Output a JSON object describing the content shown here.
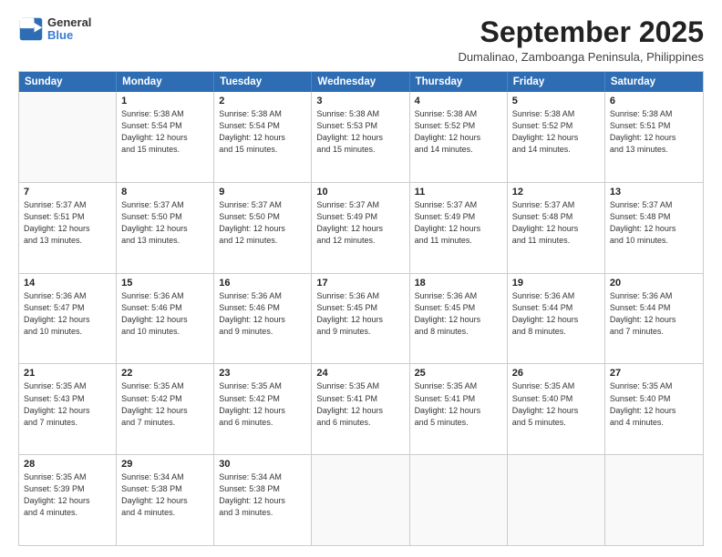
{
  "header": {
    "logo": {
      "line1": "General",
      "line2": "Blue"
    },
    "title": "September 2025",
    "subtitle": "Dumalinao, Zamboanga Peninsula, Philippines"
  },
  "calendar": {
    "days": [
      "Sunday",
      "Monday",
      "Tuesday",
      "Wednesday",
      "Thursday",
      "Friday",
      "Saturday"
    ],
    "weeks": [
      [
        {
          "day": "",
          "empty": true
        },
        {
          "day": "1",
          "line1": "Sunrise: 5:38 AM",
          "line2": "Sunset: 5:54 PM",
          "line3": "Daylight: 12 hours",
          "line4": "and 15 minutes."
        },
        {
          "day": "2",
          "line1": "Sunrise: 5:38 AM",
          "line2": "Sunset: 5:54 PM",
          "line3": "Daylight: 12 hours",
          "line4": "and 15 minutes."
        },
        {
          "day": "3",
          "line1": "Sunrise: 5:38 AM",
          "line2": "Sunset: 5:53 PM",
          "line3": "Daylight: 12 hours",
          "line4": "and 15 minutes."
        },
        {
          "day": "4",
          "line1": "Sunrise: 5:38 AM",
          "line2": "Sunset: 5:52 PM",
          "line3": "Daylight: 12 hours",
          "line4": "and 14 minutes."
        },
        {
          "day": "5",
          "line1": "Sunrise: 5:38 AM",
          "line2": "Sunset: 5:52 PM",
          "line3": "Daylight: 12 hours",
          "line4": "and 14 minutes."
        },
        {
          "day": "6",
          "line1": "Sunrise: 5:38 AM",
          "line2": "Sunset: 5:51 PM",
          "line3": "Daylight: 12 hours",
          "line4": "and 13 minutes."
        }
      ],
      [
        {
          "day": "7",
          "line1": "Sunrise: 5:37 AM",
          "line2": "Sunset: 5:51 PM",
          "line3": "Daylight: 12 hours",
          "line4": "and 13 minutes."
        },
        {
          "day": "8",
          "line1": "Sunrise: 5:37 AM",
          "line2": "Sunset: 5:50 PM",
          "line3": "Daylight: 12 hours",
          "line4": "and 13 minutes."
        },
        {
          "day": "9",
          "line1": "Sunrise: 5:37 AM",
          "line2": "Sunset: 5:50 PM",
          "line3": "Daylight: 12 hours",
          "line4": "and 12 minutes."
        },
        {
          "day": "10",
          "line1": "Sunrise: 5:37 AM",
          "line2": "Sunset: 5:49 PM",
          "line3": "Daylight: 12 hours",
          "line4": "and 12 minutes."
        },
        {
          "day": "11",
          "line1": "Sunrise: 5:37 AM",
          "line2": "Sunset: 5:49 PM",
          "line3": "Daylight: 12 hours",
          "line4": "and 11 minutes."
        },
        {
          "day": "12",
          "line1": "Sunrise: 5:37 AM",
          "line2": "Sunset: 5:48 PM",
          "line3": "Daylight: 12 hours",
          "line4": "and 11 minutes."
        },
        {
          "day": "13",
          "line1": "Sunrise: 5:37 AM",
          "line2": "Sunset: 5:48 PM",
          "line3": "Daylight: 12 hours",
          "line4": "and 10 minutes."
        }
      ],
      [
        {
          "day": "14",
          "line1": "Sunrise: 5:36 AM",
          "line2": "Sunset: 5:47 PM",
          "line3": "Daylight: 12 hours",
          "line4": "and 10 minutes."
        },
        {
          "day": "15",
          "line1": "Sunrise: 5:36 AM",
          "line2": "Sunset: 5:46 PM",
          "line3": "Daylight: 12 hours",
          "line4": "and 10 minutes."
        },
        {
          "day": "16",
          "line1": "Sunrise: 5:36 AM",
          "line2": "Sunset: 5:46 PM",
          "line3": "Daylight: 12 hours",
          "line4": "and 9 minutes."
        },
        {
          "day": "17",
          "line1": "Sunrise: 5:36 AM",
          "line2": "Sunset: 5:45 PM",
          "line3": "Daylight: 12 hours",
          "line4": "and 9 minutes."
        },
        {
          "day": "18",
          "line1": "Sunrise: 5:36 AM",
          "line2": "Sunset: 5:45 PM",
          "line3": "Daylight: 12 hours",
          "line4": "and 8 minutes."
        },
        {
          "day": "19",
          "line1": "Sunrise: 5:36 AM",
          "line2": "Sunset: 5:44 PM",
          "line3": "Daylight: 12 hours",
          "line4": "and 8 minutes."
        },
        {
          "day": "20",
          "line1": "Sunrise: 5:36 AM",
          "line2": "Sunset: 5:44 PM",
          "line3": "Daylight: 12 hours",
          "line4": "and 7 minutes."
        }
      ],
      [
        {
          "day": "21",
          "line1": "Sunrise: 5:35 AM",
          "line2": "Sunset: 5:43 PM",
          "line3": "Daylight: 12 hours",
          "line4": "and 7 minutes."
        },
        {
          "day": "22",
          "line1": "Sunrise: 5:35 AM",
          "line2": "Sunset: 5:42 PM",
          "line3": "Daylight: 12 hours",
          "line4": "and 7 minutes."
        },
        {
          "day": "23",
          "line1": "Sunrise: 5:35 AM",
          "line2": "Sunset: 5:42 PM",
          "line3": "Daylight: 12 hours",
          "line4": "and 6 minutes."
        },
        {
          "day": "24",
          "line1": "Sunrise: 5:35 AM",
          "line2": "Sunset: 5:41 PM",
          "line3": "Daylight: 12 hours",
          "line4": "and 6 minutes."
        },
        {
          "day": "25",
          "line1": "Sunrise: 5:35 AM",
          "line2": "Sunset: 5:41 PM",
          "line3": "Daylight: 12 hours",
          "line4": "and 5 minutes."
        },
        {
          "day": "26",
          "line1": "Sunrise: 5:35 AM",
          "line2": "Sunset: 5:40 PM",
          "line3": "Daylight: 12 hours",
          "line4": "and 5 minutes."
        },
        {
          "day": "27",
          "line1": "Sunrise: 5:35 AM",
          "line2": "Sunset: 5:40 PM",
          "line3": "Daylight: 12 hours",
          "line4": "and 4 minutes."
        }
      ],
      [
        {
          "day": "28",
          "line1": "Sunrise: 5:35 AM",
          "line2": "Sunset: 5:39 PM",
          "line3": "Daylight: 12 hours",
          "line4": "and 4 minutes."
        },
        {
          "day": "29",
          "line1": "Sunrise: 5:34 AM",
          "line2": "Sunset: 5:38 PM",
          "line3": "Daylight: 12 hours",
          "line4": "and 4 minutes."
        },
        {
          "day": "30",
          "line1": "Sunrise: 5:34 AM",
          "line2": "Sunset: 5:38 PM",
          "line3": "Daylight: 12 hours",
          "line4": "and 3 minutes."
        },
        {
          "day": "",
          "empty": true
        },
        {
          "day": "",
          "empty": true
        },
        {
          "day": "",
          "empty": true
        },
        {
          "day": "",
          "empty": true
        }
      ]
    ]
  }
}
